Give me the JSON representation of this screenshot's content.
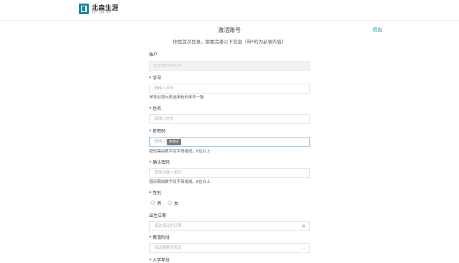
{
  "header": {
    "logo_title": "北森生涯",
    "logo_subtitle": "职业 · 自我 · 成长"
  },
  "page": {
    "title": "激活账号",
    "subtitle": "你是首次登录，需要完善以下信息（带*的为必填内容）",
    "logout_label": "退出"
  },
  "form": {
    "account": {
      "label": "账户",
      "value": "S1000765474"
    },
    "student_id": {
      "label": "* 学号",
      "placeholder": "请输入学号",
      "hint": "学号必须与所选学校的学号一致"
    },
    "name": {
      "label": "* 姓名",
      "placeholder": "请输入姓名"
    },
    "new_password": {
      "label": "* 新密码",
      "placeholder": "请输入新密码",
      "tooltip": "新密码",
      "hint": "密码需由数字及字母组成，8位以上"
    },
    "confirm_password": {
      "label": "* 确认密码",
      "placeholder": "请再次输入密码",
      "hint": "密码需由数字及字母组成，8位以上"
    },
    "gender": {
      "label": "* 性别",
      "options": [
        "男",
        "女"
      ]
    },
    "birthday": {
      "label": "出生日期",
      "placeholder": "请选择出生日期"
    },
    "education": {
      "label": "* 教育阶段",
      "placeholder": "请选择教育阶段"
    },
    "next_field": {
      "label": "* 入学年份"
    }
  }
}
